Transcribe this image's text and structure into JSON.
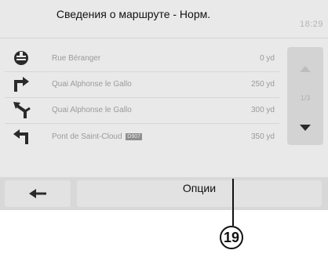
{
  "header": {
    "title": "Сведения о маршруте - Норм.",
    "clock": "18:29"
  },
  "route_steps": [
    {
      "icon": "destination-icon",
      "street": "Rue Béranger",
      "distance": "0 yd"
    },
    {
      "icon": "turn-right-icon",
      "street": "Quai Alphonse le Gallo",
      "distance": "250 yd"
    },
    {
      "icon": "bear-left-icon",
      "street": "Quai Alphonse le Gallo",
      "distance": "300 yd"
    },
    {
      "icon": "turn-left-icon",
      "street": "Pont de Saint-Cloud",
      "badge": "D907",
      "distance": "350 yd"
    }
  ],
  "scroll": {
    "page_indicator": "1/3"
  },
  "bottom_bar": {
    "options_label": "Опции"
  },
  "callout": {
    "number": "19"
  }
}
